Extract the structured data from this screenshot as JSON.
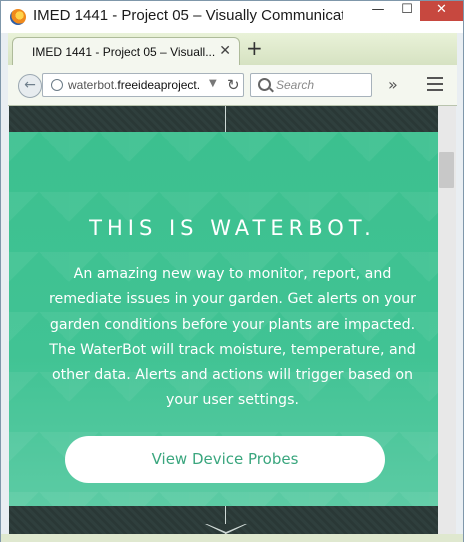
{
  "window": {
    "title": "IMED 1441 - Project 05 – Visually Communicati...",
    "minimize_glyph": "—",
    "maximize_glyph": "☐",
    "close_glyph": "✕"
  },
  "tab": {
    "label": "IMED 1441 - Project 05 – Visuall...",
    "close_glyph": "✕",
    "new_tab_glyph": "+"
  },
  "navbar": {
    "url_prefix": "waterbot.",
    "url_host": "freeideaproject.",
    "search_placeholder": "Search",
    "back_glyph": "←",
    "reload_glyph": "↻",
    "dropdown_glyph": "▼",
    "overflow_glyph": "»"
  },
  "hero": {
    "title": "THIS IS WATERBOT.",
    "description": "An amazing new way to monitor, report, and remediate issues in your garden. Get alerts on your garden conditions before your plants are impacted. The WaterBot will track moisture, temperature, and other data. Alerts and actions will trigger based on your user settings.",
    "button_label": "View Device Probes"
  },
  "colors": {
    "hero_green": "#41c394",
    "button_text": "#3aa67e",
    "close_red": "#c7483f"
  },
  "icons": [
    "firefox-icon",
    "globe-icon",
    "search-icon",
    "reload-icon",
    "menu-icon",
    "overflow-icon",
    "back-arrow-icon"
  ]
}
